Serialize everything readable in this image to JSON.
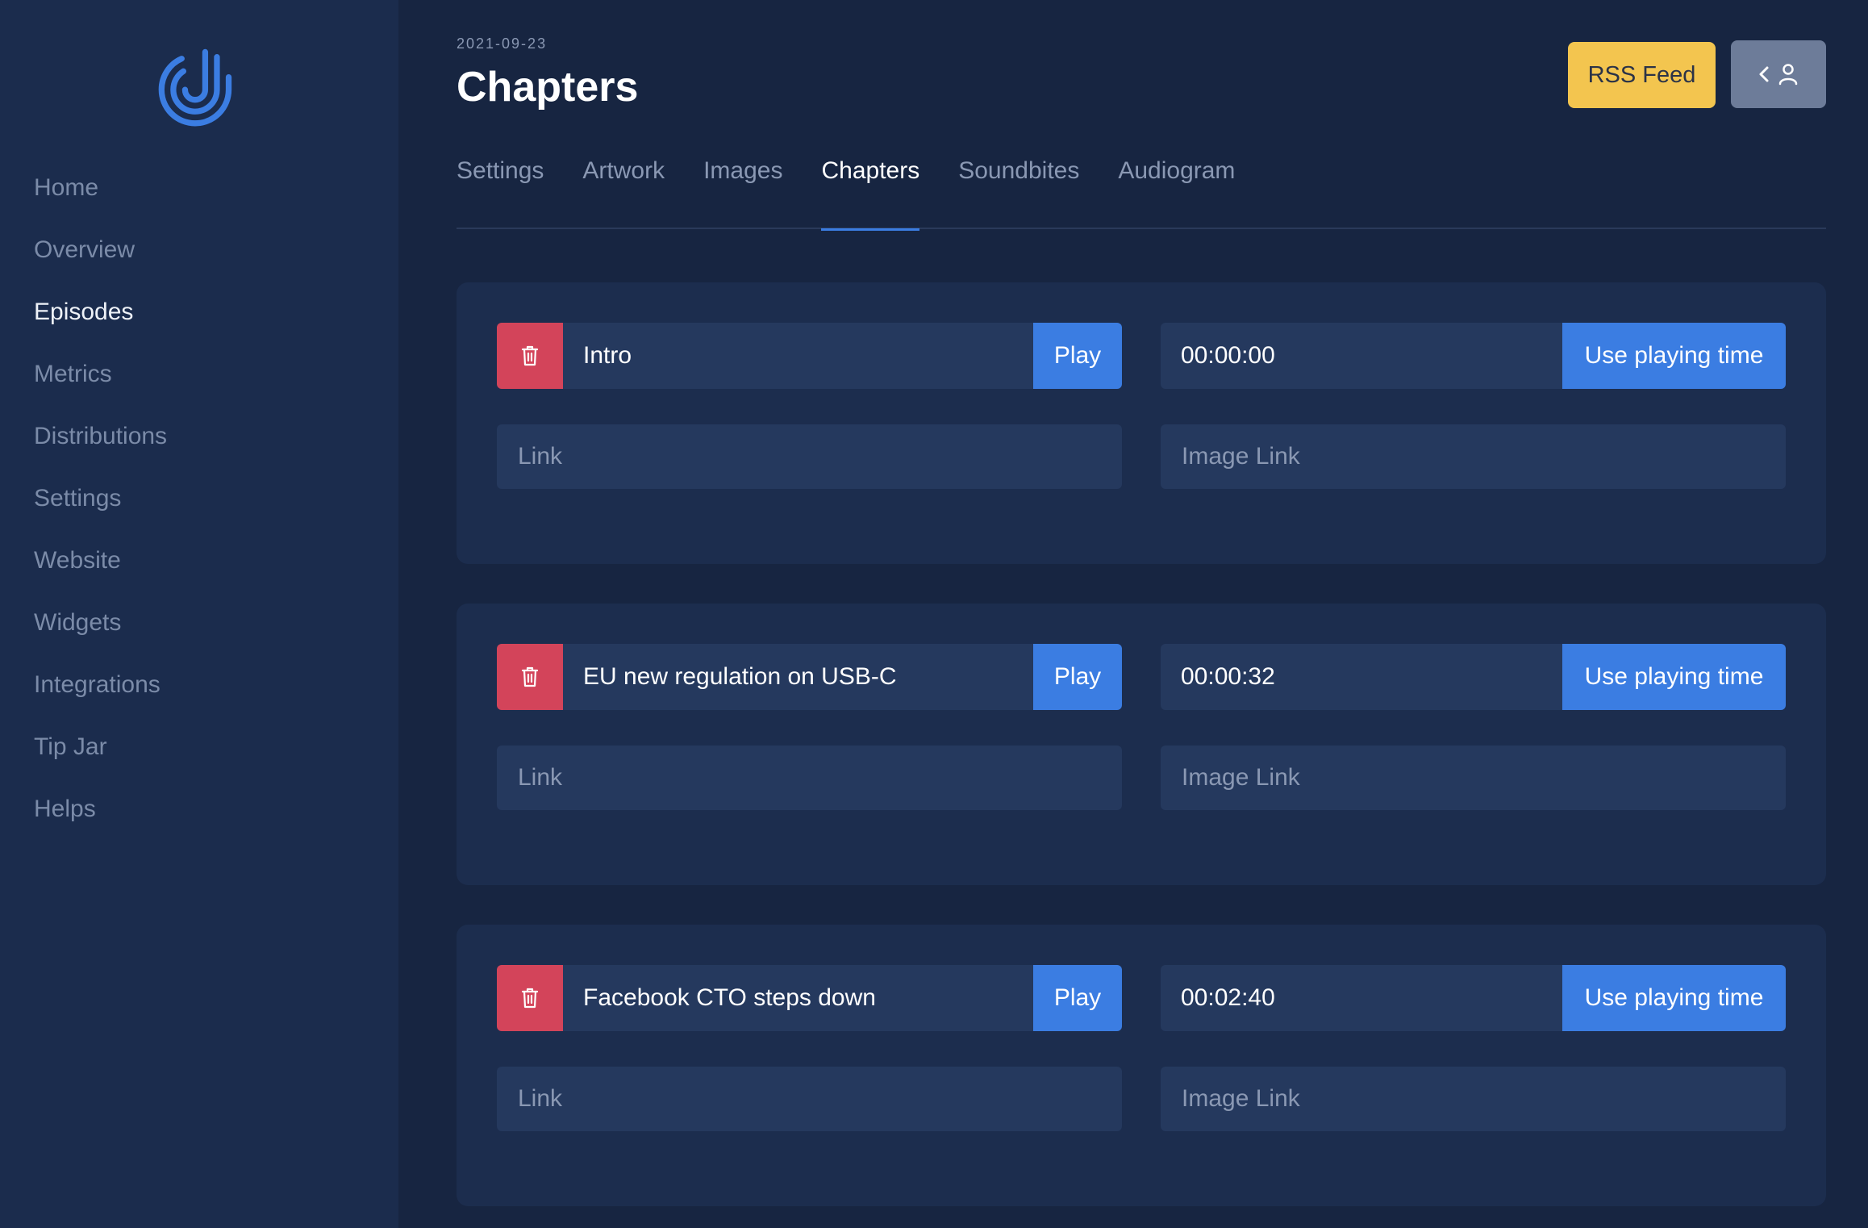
{
  "sidebar": {
    "logo": "jockey-logo-icon",
    "items": [
      {
        "label": "Home"
      },
      {
        "label": "Overview"
      },
      {
        "label": "Episodes"
      },
      {
        "label": "Metrics"
      },
      {
        "label": "Distributions"
      },
      {
        "label": "Settings"
      },
      {
        "label": "Website"
      },
      {
        "label": "Widgets"
      },
      {
        "label": "Integrations"
      },
      {
        "label": "Tip Jar"
      },
      {
        "label": "Helps"
      }
    ],
    "active": "Episodes"
  },
  "header": {
    "date": "2021-09-23",
    "title": "Chapters",
    "rss_label": "RSS Feed",
    "profile_icons": [
      "chevron-left-icon",
      "user-icon"
    ]
  },
  "tabs": [
    {
      "label": "Settings"
    },
    {
      "label": "Artwork"
    },
    {
      "label": "Images"
    },
    {
      "label": "Chapters"
    },
    {
      "label": "Soundbites"
    },
    {
      "label": "Audiogram"
    }
  ],
  "active_tab": "Chapters",
  "chapter_labels": {
    "play": "Play",
    "use_time": "Use playing time",
    "link_placeholder": "Link",
    "image_placeholder": "Image Link"
  },
  "chapters": [
    {
      "title": "Intro",
      "time": "00:00:00"
    },
    {
      "title": "EU new regulation on USB-C",
      "time": "00:00:32"
    },
    {
      "title": "Facebook CTO steps down",
      "time": "00:02:40"
    }
  ],
  "colors": {
    "background": "#172541",
    "sidebar": "#1b2c4d",
    "card": "#1c2d4e",
    "input": "#25395e",
    "accent": "#3b7de2",
    "danger": "#d3445a",
    "rss": "#f3c54f"
  }
}
